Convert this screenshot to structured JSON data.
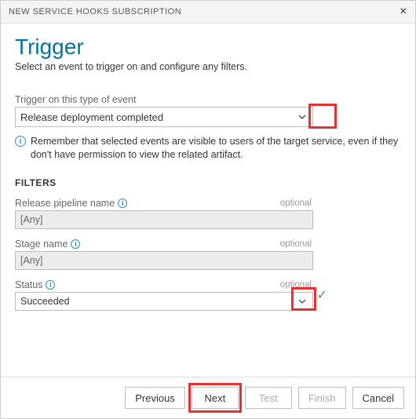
{
  "dialog": {
    "title": "NEW SERVICE HOOKS SUBSCRIPTION"
  },
  "page": {
    "heading": "Trigger",
    "subtitle": "Select an event to trigger on and configure any filters."
  },
  "event": {
    "label": "Trigger on this type of event",
    "value": "Release deployment completed"
  },
  "note": "Remember that selected events are visible to users of the target service, even if they don't have permission to view the related artifact.",
  "filters_heading": "FILTERS",
  "filters": {
    "pipeline": {
      "label": "Release pipeline name",
      "optional": "optional",
      "value": "[Any]"
    },
    "stage": {
      "label": "Stage name",
      "optional": "optional",
      "value": "[Any]"
    },
    "status": {
      "label": "Status",
      "optional": "optional",
      "value": "Succeeded"
    }
  },
  "buttons": {
    "previous": "Previous",
    "next": "Next",
    "test": "Test",
    "finish": "Finish",
    "cancel": "Cancel"
  }
}
